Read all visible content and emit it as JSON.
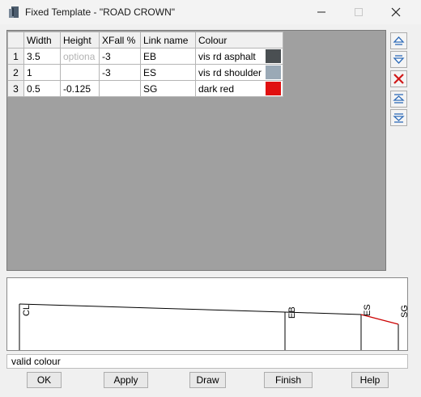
{
  "window": {
    "title": "Fixed Template - \"ROAD CROWN\"",
    "icon": "template-app-icon"
  },
  "grid": {
    "columns": [
      "Width",
      "Height",
      "XFall %",
      "Link name",
      "Colour"
    ],
    "rows": [
      {
        "num": "1",
        "width": "3.5",
        "height": "",
        "height_placeholder": "optiona",
        "xfall": "-3",
        "link": "EB",
        "colour": "vis rd asphalt",
        "swatch": "#4a4f52"
      },
      {
        "num": "2",
        "width": "1",
        "height": "",
        "height_placeholder": "",
        "xfall": "-3",
        "link": "ES",
        "colour": "vis rd shoulder",
        "swatch": "#9aa9b6"
      },
      {
        "num": "3",
        "width": "0.5",
        "height": "-0.125",
        "height_placeholder": "",
        "xfall": "",
        "link": "SG",
        "colour": "dark red",
        "swatch": "#e01010"
      }
    ]
  },
  "sidebar": {
    "buttons": [
      "move-row-up-icon",
      "move-row-down-icon",
      "delete-row-icon",
      "insert-row-above-icon",
      "insert-row-below-icon"
    ]
  },
  "drawing": {
    "labels": {
      "cl": "CL",
      "eb": "EB",
      "es": "ES",
      "sg": "SG"
    },
    "colors": {
      "line": "#000000",
      "sg_segment": "#cc0000"
    }
  },
  "status": {
    "text": "valid colour"
  },
  "buttons": {
    "ok": "OK",
    "apply": "Apply",
    "draw": "Draw",
    "finish": "Finish",
    "help": "Help"
  }
}
